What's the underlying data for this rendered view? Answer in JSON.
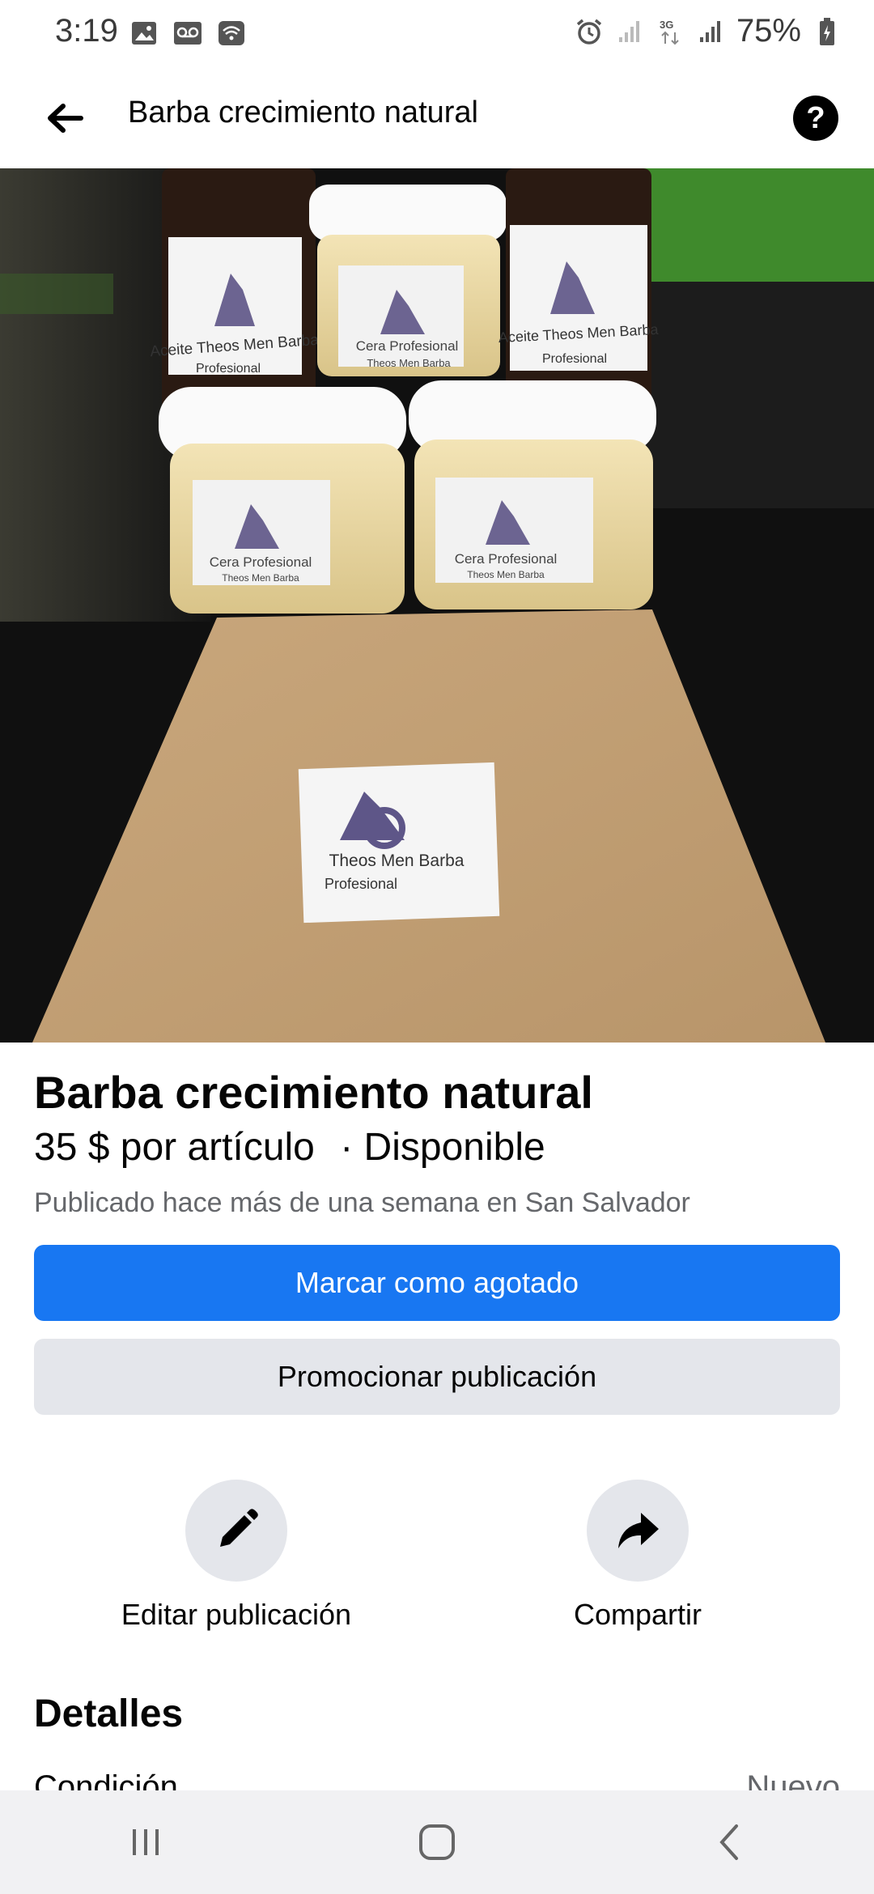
{
  "status_bar": {
    "time": "3:19",
    "battery": "75%",
    "left_icons": [
      "image-icon",
      "voicemail-icon",
      "wifi-icon"
    ],
    "right_icons": [
      "alarm-icon",
      "signal-icon",
      "network-3g-icon",
      "signal-icon",
      "battery-icon"
    ]
  },
  "app_bar": {
    "title": "Barba crecimiento natural",
    "help_label": "?"
  },
  "photo": {
    "labels": {
      "bottle_left_line1": "Aceite Theos Men Barba",
      "bottle_left_line2": "Profesional",
      "jar_top_line1": "Cera Profesional",
      "jar_top_line2": "Theos Men Barba",
      "bottle_right_line1": "Aceite Theos Men Barba",
      "bottle_right_line2": "Profesional",
      "jar_left_line1": "Cera Profesional",
      "jar_left_line2": "Theos Men Barba",
      "jar_right_line1": "Cera Profesional",
      "jar_right_line2": "Theos Men Barba",
      "bag_line1": "Theos Men Barba",
      "bag_line2": "Profesional"
    }
  },
  "listing": {
    "title": "Barba crecimiento natural",
    "price": "35 $ por artículo",
    "availability": "· Disponible",
    "meta": "Publicado hace más de una semana en San Salvador",
    "primary_button": "Marcar como agotado",
    "secondary_button": "Promocionar publicación"
  },
  "actions": {
    "edit_label": "Editar publicación",
    "share_label": "Compartir"
  },
  "details": {
    "heading": "Detalles",
    "condition_label": "Condición",
    "condition_value": "Nuevo"
  },
  "colors": {
    "accent": "#1877f2",
    "secondary_bg": "#e4e6eb",
    "muted_text": "#65676b"
  }
}
